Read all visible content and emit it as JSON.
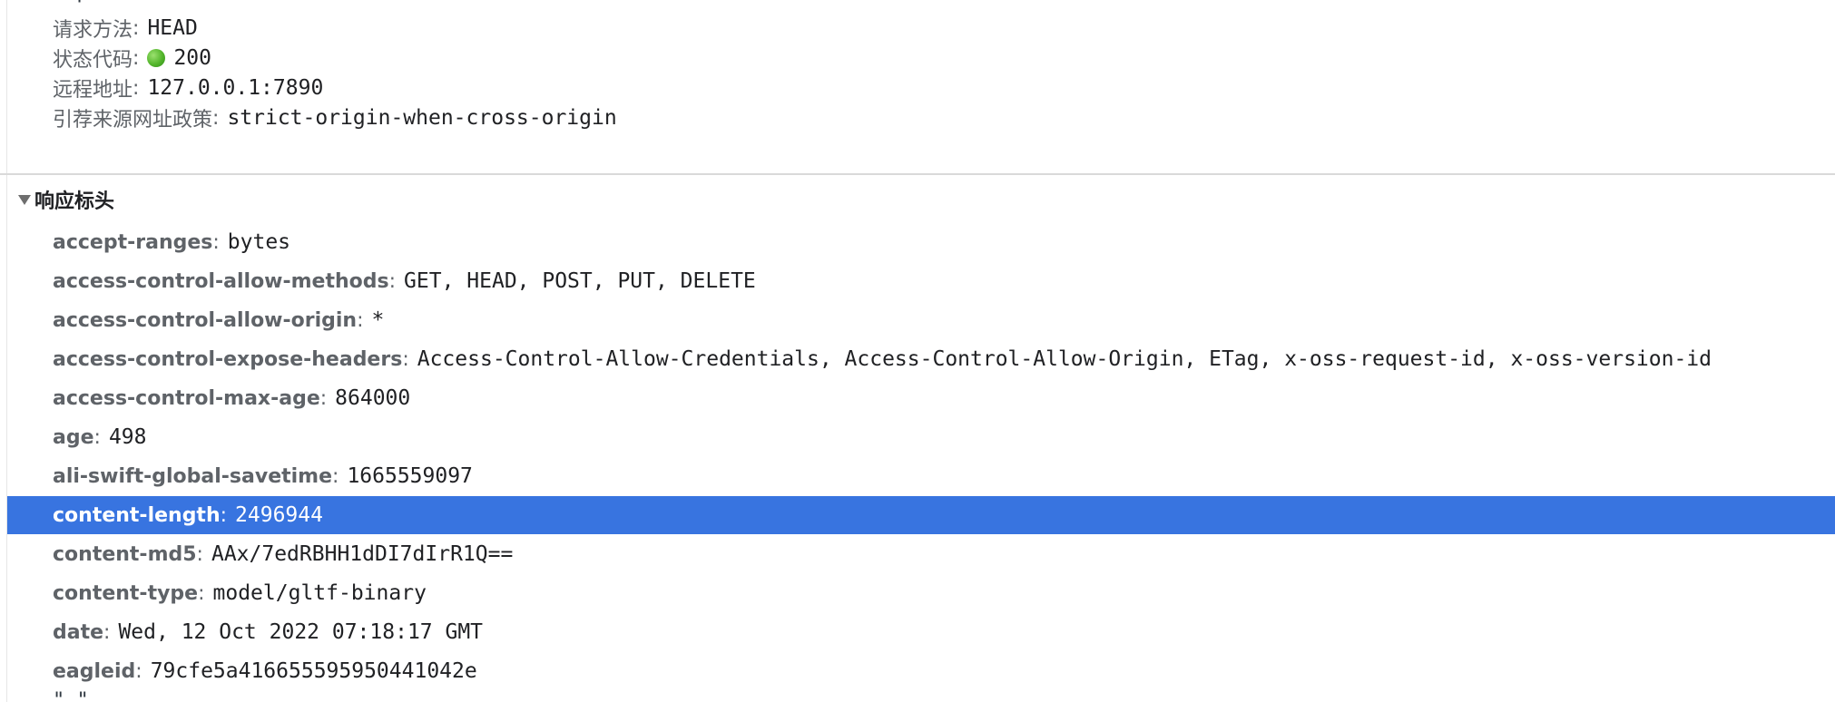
{
  "general": {
    "clipped_top_text": "r   p",
    "rows": [
      {
        "label": "请求方法",
        "value": "HEAD"
      },
      {
        "label": "状态代码",
        "value": "200"
      },
      {
        "label": "远程地址",
        "value": "127.0.0.1:7890"
      },
      {
        "label": "引荐来源网址政策",
        "value": "strict-origin-when-cross-origin"
      }
    ],
    "status_color": "#4caf2a"
  },
  "response_headers": {
    "title": "响应标头",
    "rows": [
      {
        "key": "accept-ranges",
        "value": "bytes"
      },
      {
        "key": "access-control-allow-methods",
        "value": "GET, HEAD, POST, PUT, DELETE"
      },
      {
        "key": "access-control-allow-origin",
        "value": "*"
      },
      {
        "key": "access-control-expose-headers",
        "value": "Access-Control-Allow-Credentials, Access-Control-Allow-Origin, ETag, x-oss-request-id, x-oss-version-id"
      },
      {
        "key": "access-control-max-age",
        "value": "864000"
      },
      {
        "key": "age",
        "value": "498"
      },
      {
        "key": "ali-swift-global-savetime",
        "value": "1665559097"
      },
      {
        "key": "content-length",
        "value": "2496944"
      },
      {
        "key": "content-md5",
        "value": "AAx/7edRBHH1dDI7dIrR1Q=="
      },
      {
        "key": "content-type",
        "value": "model/gltf-binary"
      },
      {
        "key": "date",
        "value": "Wed, 12 Oct 2022 07:18:17 GMT"
      },
      {
        "key": "eagleid",
        "value": "79cfe5a416655595950441042e"
      }
    ],
    "selected_index": 7,
    "clipped_bottom_text": "\"                \""
  },
  "colors": {
    "selection": "#3874e0",
    "key_text": "#5f6368",
    "value_text": "#202124"
  }
}
